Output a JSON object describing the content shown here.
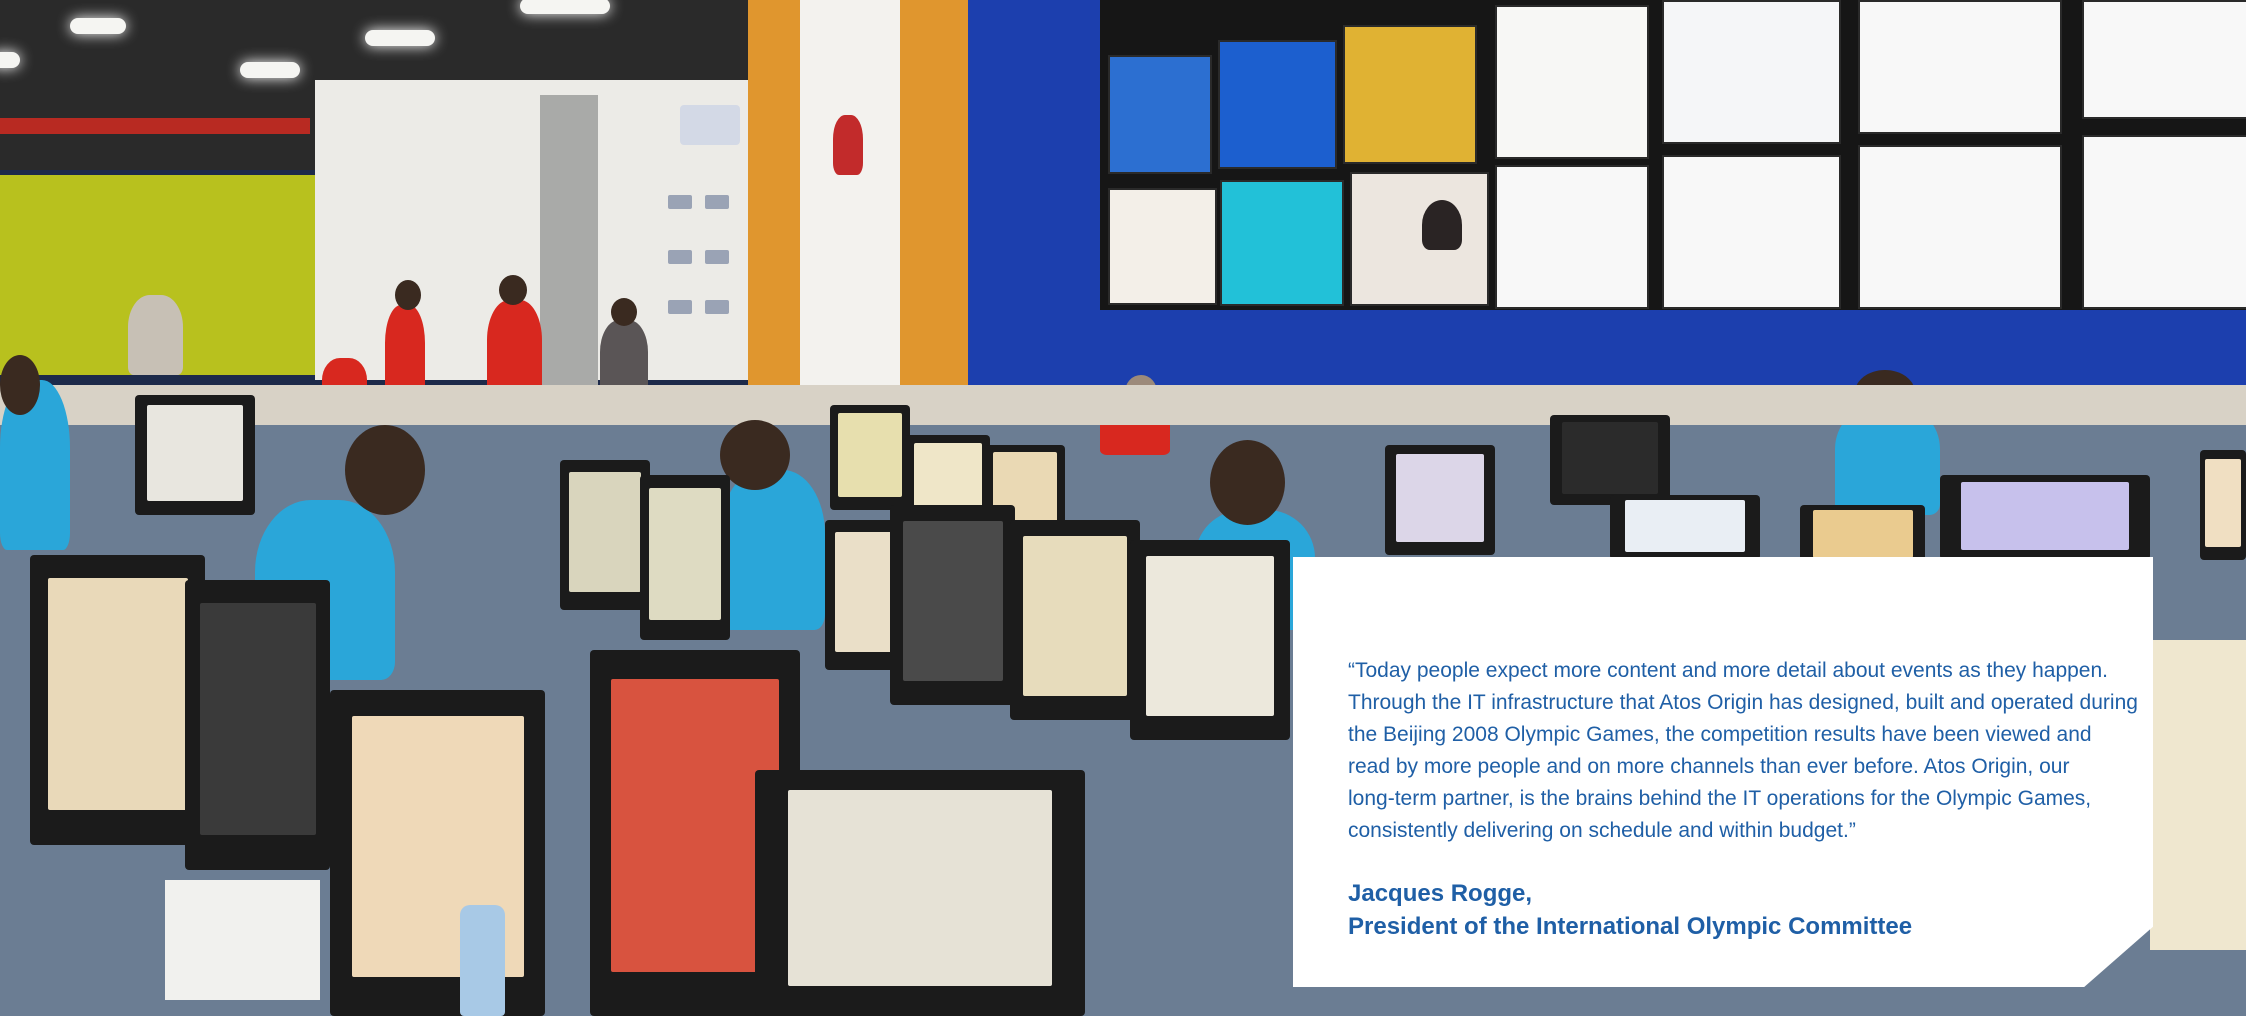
{
  "quote": {
    "lines": [
      "“Today people expect more content and more detail about events as they happen.",
      "Through the IT infrastructure that Atos Origin has designed, built and operated during",
      "the Beijing 2008 Olympic Games, the competition results have been viewed and",
      "read by more people and on more channels than ever before. Atos Origin, our",
      "long-term partner, is the brains behind the IT operations for the Olympic Games,",
      "consistently delivering on schedule and within budget.”"
    ],
    "author": "Jacques Rogge,",
    "author_title": "President of the International Olympic Committee"
  },
  "colors": {
    "quote_text": "#1f5fa6",
    "blue_wall": "#1c3fae",
    "volunteer_shirt": "#2aa6d9",
    "staff_shirt": "#d8281f"
  }
}
